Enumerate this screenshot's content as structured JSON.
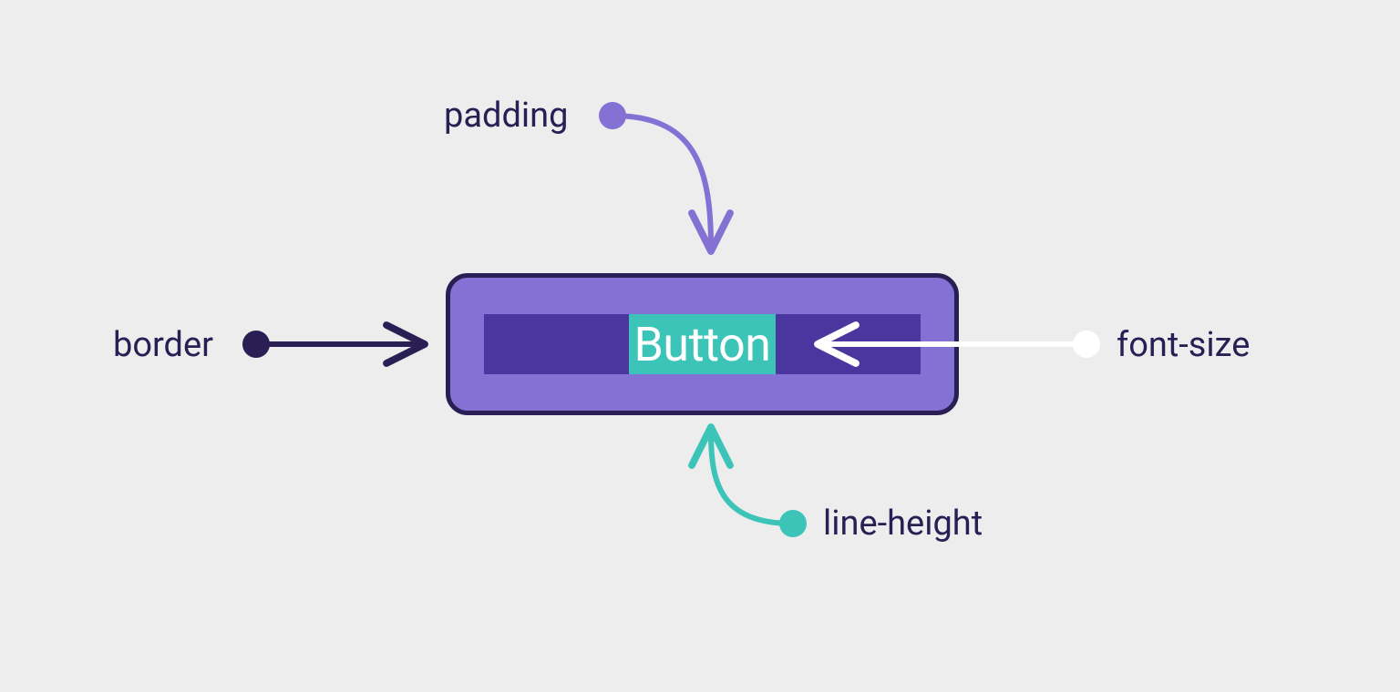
{
  "button": {
    "label": "Button"
  },
  "annotations": {
    "padding": "padding",
    "border": "border",
    "fontsize": "font-size",
    "lineheight": "line-height"
  },
  "colors": {
    "background": "#ededed",
    "border_dark": "#2a1f54",
    "padding_purple": "#8471d4",
    "inner_purple": "#4b359f",
    "teal": "#3cc4b9",
    "white": "#ffffff",
    "text_dark": "#2a1f54"
  }
}
